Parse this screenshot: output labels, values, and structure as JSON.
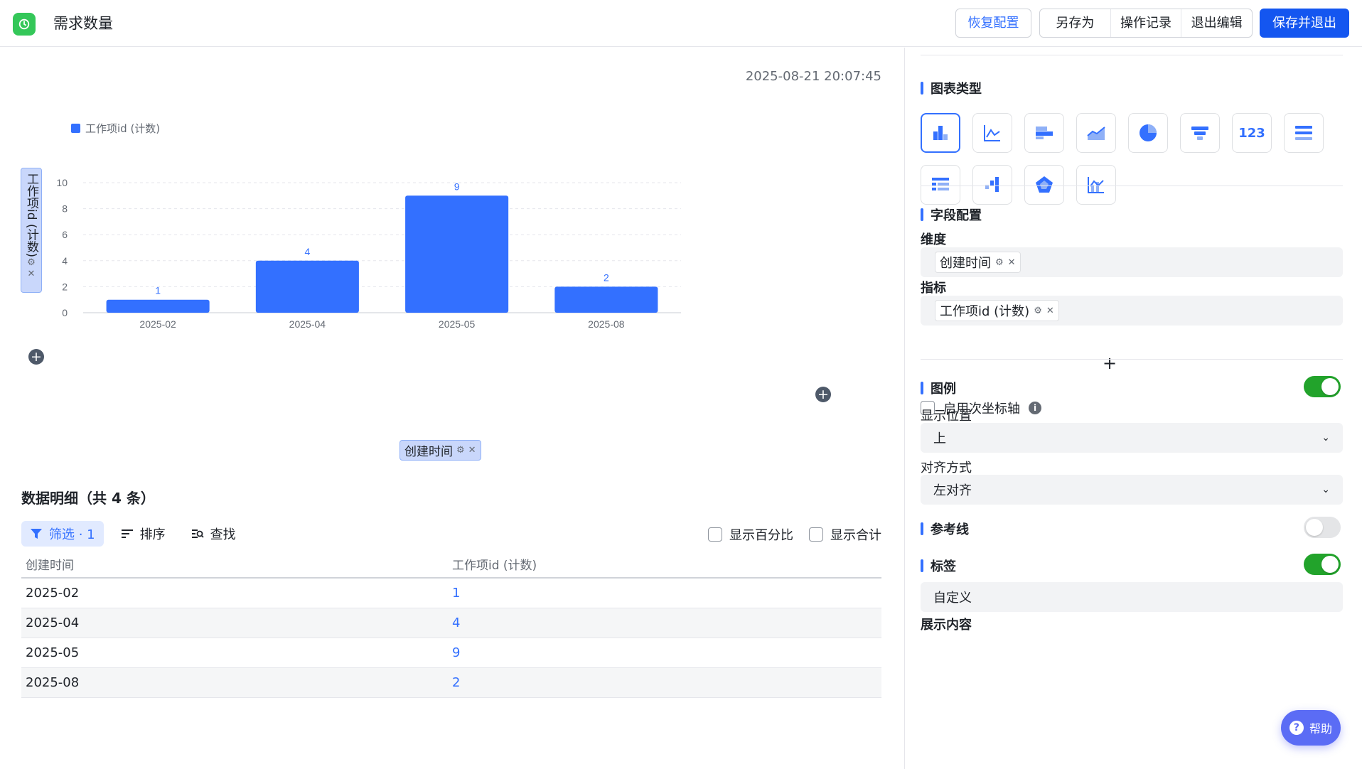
{
  "header": {
    "title": "需求数量",
    "buttons": {
      "restore": "恢复配置",
      "save_as": "另存为",
      "history": "操作记录",
      "exit_edit": "退出编辑",
      "save_exit": "保存并退出"
    }
  },
  "main": {
    "timestamp": "2025-08-21 20:07:45",
    "y_axis_field": "工作项id (计数)",
    "x_axis_field": "创建时间",
    "details_title": "数据明细（共 4 条）",
    "toolbar": {
      "filter": "筛选 · 1",
      "sort": "排序",
      "find": "查找"
    },
    "options": {
      "show_percent": "显示百分比",
      "show_total": "显示合计"
    },
    "table": {
      "columns": [
        "创建时间",
        "工作项id (计数)"
      ],
      "rows": [
        [
          "2025-02",
          "1"
        ],
        [
          "2025-04",
          "4"
        ],
        [
          "2025-05",
          "9"
        ],
        [
          "2025-08",
          "2"
        ]
      ]
    }
  },
  "chart_data": {
    "type": "bar",
    "categories": [
      "2025-02",
      "2025-04",
      "2025-05",
      "2025-08"
    ],
    "series": [
      {
        "name": "工作项id (计数)",
        "values": [
          1,
          4,
          9,
          2
        ]
      }
    ],
    "ylim": [
      0,
      10
    ],
    "yticks": [
      0,
      2,
      4,
      6,
      8,
      10
    ],
    "legend": "top-left",
    "grid": true,
    "color": "#3370ff"
  },
  "sidebar": {
    "chart_type_title": "图表类型",
    "chart_types": [
      "bar-chart-icon",
      "line-chart-icon",
      "horizontal-bar-icon",
      "area-chart-icon",
      "pie-chart-icon",
      "funnel-icon",
      "123",
      "list-icon",
      "table-icon",
      "waterfall-icon",
      "radar-icon",
      "combo-chart-icon"
    ],
    "field_config_title": "字段配置",
    "dimension_label": "维度",
    "dimension_chip": "创建时间",
    "metric_label": "指标",
    "metric_chip": "工作项id (计数)",
    "secondary_axis": "启用次坐标轴",
    "legend_title": "图例",
    "position_label": "显示位置",
    "position_value": "上",
    "align_label": "对齐方式",
    "align_value": "左对齐",
    "refline_title": "参考线",
    "labels_title": "标签",
    "label_mode": "自定义",
    "display_content": "展示内容",
    "help": "帮助"
  }
}
